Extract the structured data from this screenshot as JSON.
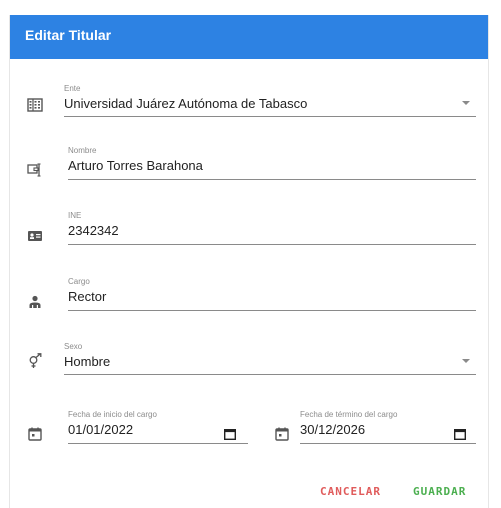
{
  "dialog": {
    "title": "Editar Titular"
  },
  "fields": {
    "ente": {
      "label": "Ente",
      "value": "Universidad Juárez Autónoma de Tabasco",
      "icon": "building-icon"
    },
    "nombre": {
      "label": "Nombre",
      "value": "Arturo Torres Barahona",
      "icon": "id-card-horizontal-icon"
    },
    "ine": {
      "label": "INE",
      "value": "2342342",
      "icon": "badge-icon"
    },
    "cargo": {
      "label": "Cargo",
      "value": "Rector",
      "icon": "person-icon"
    },
    "sexo": {
      "label": "Sexo",
      "value": "Hombre",
      "icon": "gender-icon"
    },
    "fecha_inicio": {
      "label": "Fecha de inicio del cargo",
      "value": "01/01/2022",
      "icon": "calendar-icon"
    },
    "fecha_termino": {
      "label": "Fecha de término del cargo",
      "value": "30/12/2026",
      "icon": "calendar-icon"
    }
  },
  "actions": {
    "cancel_label": "CANCELAR",
    "save_label": "GUARDAR"
  },
  "colors": {
    "header": "#2d82e3",
    "cancel": "#e05b5b",
    "save": "#4caf50"
  }
}
